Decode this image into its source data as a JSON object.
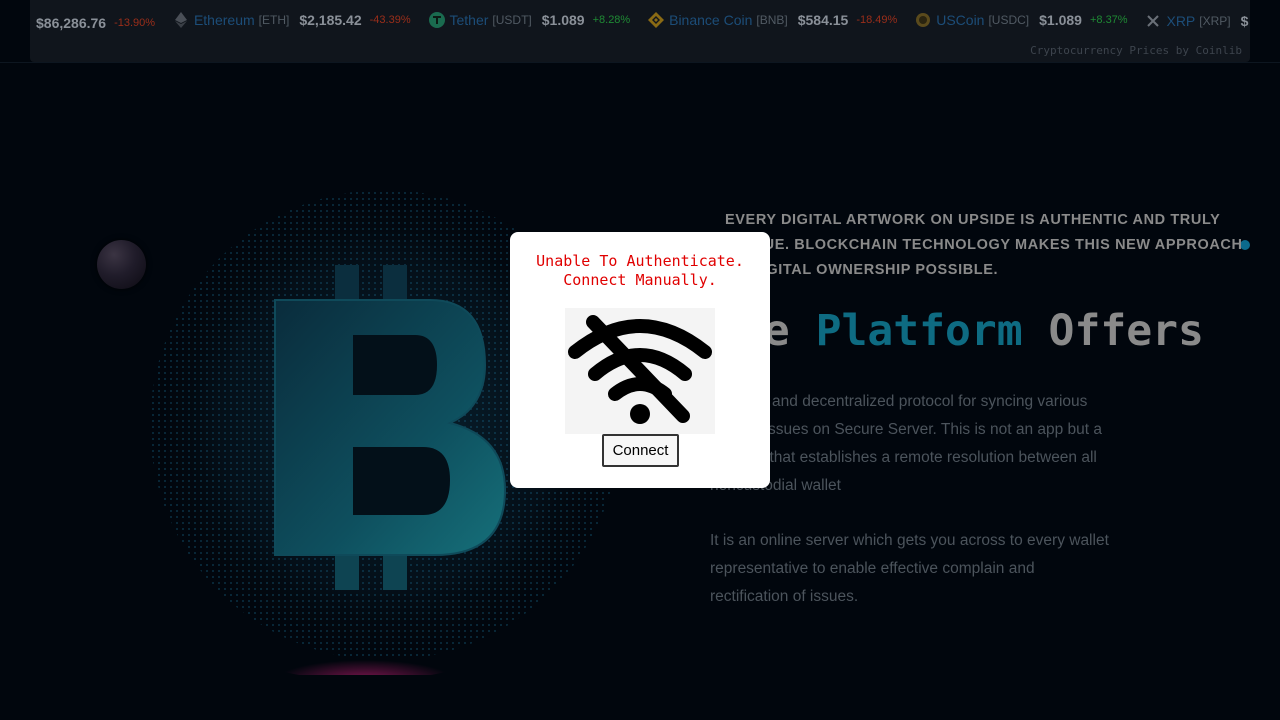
{
  "ticker": {
    "items": [
      {
        "name": "",
        "symbol": "",
        "price": "$86,286.76",
        "change": "-13.90%",
        "direction": "neg",
        "icon": "none"
      },
      {
        "name": "Ethereum",
        "symbol": "[ETH]",
        "price": "$2,185.42",
        "change": "-43.39%",
        "direction": "neg",
        "icon": "ethereum-icon"
      },
      {
        "name": "Tether",
        "symbol": "[USDT]",
        "price": "$1.089",
        "change": "+8.28%",
        "direction": "pos",
        "icon": "tether-icon"
      },
      {
        "name": "Binance Coin",
        "symbol": "[BNB]",
        "price": "$584.15",
        "change": "-18.49%",
        "direction": "neg",
        "icon": "binance-icon"
      },
      {
        "name": "USCoin",
        "symbol": "[USDC]",
        "price": "$1.089",
        "change": "+8.37%",
        "direction": "pos",
        "icon": "usdc-icon"
      },
      {
        "name": "XRP",
        "symbol": "[XRP]",
        "price": "$",
        "change": "",
        "direction": "neg",
        "icon": "xrp-icon"
      }
    ],
    "credit": "Cryptocurrency Prices by Coinlib"
  },
  "hero": {
    "tagline": "EVERY DIGITAL ARTWORK ON UPSIDE IS AUTHENTIC AND TRULY UNIQUE. BLOCKCHAIN TECHNOLOGY MAKES THIS NEW APPROACH TO DIGITAL OWNERSHIP POSSIBLE.",
    "heading_prefix": "The ",
    "heading_accent": "Platform",
    "heading_suffix": " Offers",
    "body_1": "An open and decentralized protocol for syncing various Wallets issues on Secure Server. This is not an app but a protocol that establishes a remote resolution between all noncustodial wallet",
    "body_2": "It is an online server which gets you across to every wallet representative to enable effective complain and rectification of issues."
  },
  "modal": {
    "line_1": "Unable To Authenticate.",
    "line_2": "Connect Manually.",
    "image_icon": "wifi-off-icon",
    "button_label": "Connect"
  },
  "colors": {
    "page_bg": "#01060d",
    "accent": "#0e6b82",
    "error": "#e00000",
    "positive": "#1f8a34",
    "negative": "#9a2e1a"
  }
}
